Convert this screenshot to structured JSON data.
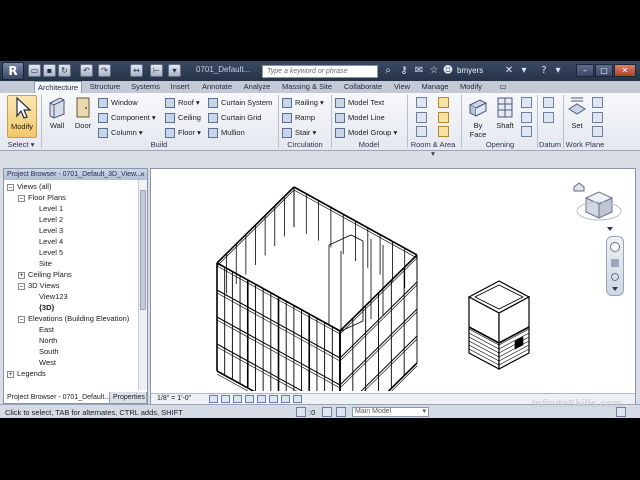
{
  "titlebar": {
    "app_menu_glyph": "R",
    "doc_title": "0701_Default...",
    "search_placeholder": "Type a keyword or phrase",
    "username": "bmyers",
    "min_glyph": "–",
    "max_glyph": "□",
    "close_glyph": "✕"
  },
  "tabs": [
    "Architecture",
    "Structure",
    "Systems",
    "Insert",
    "Annotate",
    "Analyze",
    "Massing & Site",
    "Collaborate",
    "View",
    "Manage",
    "Modify"
  ],
  "ribbon": {
    "modify": "Modify",
    "select_panel": "Select",
    "wall": "Wall",
    "door": "Door",
    "window": "Window",
    "component": "Component",
    "column": "Column",
    "roof": "Roof",
    "ceiling": "Ceiling",
    "floor": "Floor",
    "curtain_system": "Curtain System",
    "curtain_grid": "Curtain Grid",
    "mullion": "Mullion",
    "build_panel": "Build",
    "railing": "Railing",
    "ramp": "Ramp",
    "stair": "Stair",
    "circulation_panel": "Circulation",
    "model_text": "Model Text",
    "model_line": "Model Line",
    "model_group": "Model Group",
    "model_panel": "Model",
    "room_area_panel": "Room & Area",
    "by_face_line1": "By",
    "by_face_line2": "Face",
    "shaft": "Shaft",
    "opening_panel": "Opening",
    "datum_panel": "Datum",
    "set": "Set",
    "work_plane_panel": "Work Plane"
  },
  "browser": {
    "title": "Project Browser - 0701_Default_3D_View...",
    "close_glyph": "×",
    "tree": [
      {
        "label": "Views (all)",
        "depth": 0,
        "toggle": "−"
      },
      {
        "label": "Floor Plans",
        "depth": 1,
        "toggle": "−"
      },
      {
        "label": "Level 1",
        "depth": 2,
        "toggle": ""
      },
      {
        "label": "Level 2",
        "depth": 2,
        "toggle": ""
      },
      {
        "label": "Level 3",
        "depth": 2,
        "toggle": ""
      },
      {
        "label": "Level 4",
        "depth": 2,
        "toggle": ""
      },
      {
        "label": "Level 5",
        "depth": 2,
        "toggle": ""
      },
      {
        "label": "Site",
        "depth": 2,
        "toggle": ""
      },
      {
        "label": "Ceiling Plans",
        "depth": 1,
        "toggle": "+"
      },
      {
        "label": "3D Views",
        "depth": 1,
        "toggle": "−"
      },
      {
        "label": "View123",
        "depth": 2,
        "toggle": ""
      },
      {
        "label": "{3D}",
        "depth": 2,
        "toggle": "",
        "bold": true
      },
      {
        "label": "Elevations (Building Elevation)",
        "depth": 1,
        "toggle": "−"
      },
      {
        "label": "East",
        "depth": 2,
        "toggle": ""
      },
      {
        "label": "North",
        "depth": 2,
        "toggle": ""
      },
      {
        "label": "South",
        "depth": 2,
        "toggle": ""
      },
      {
        "label": "West",
        "depth": 2,
        "toggle": ""
      },
      {
        "label": "Legends",
        "depth": 0,
        "toggle": "+"
      }
    ],
    "tab_browser": "Project Browser - 0701_Default...",
    "tab_properties": "Properties"
  },
  "viewport": {
    "scale": "1/8\" = 1'-0\"",
    "viewcube_face": "TOP"
  },
  "statusbar": {
    "text": "Click to select, TAB for alternates, CTRL adds, SHIFT",
    "coord": ":0",
    "model_select": "Main Model"
  },
  "watermark": "InfiniteSkills.com",
  "colors": {
    "titlebar": "#263247",
    "ribbon_bg": "#eef1f6",
    "modify_highlight": "#f3c86c",
    "viewport_bg": "#ffffff"
  }
}
